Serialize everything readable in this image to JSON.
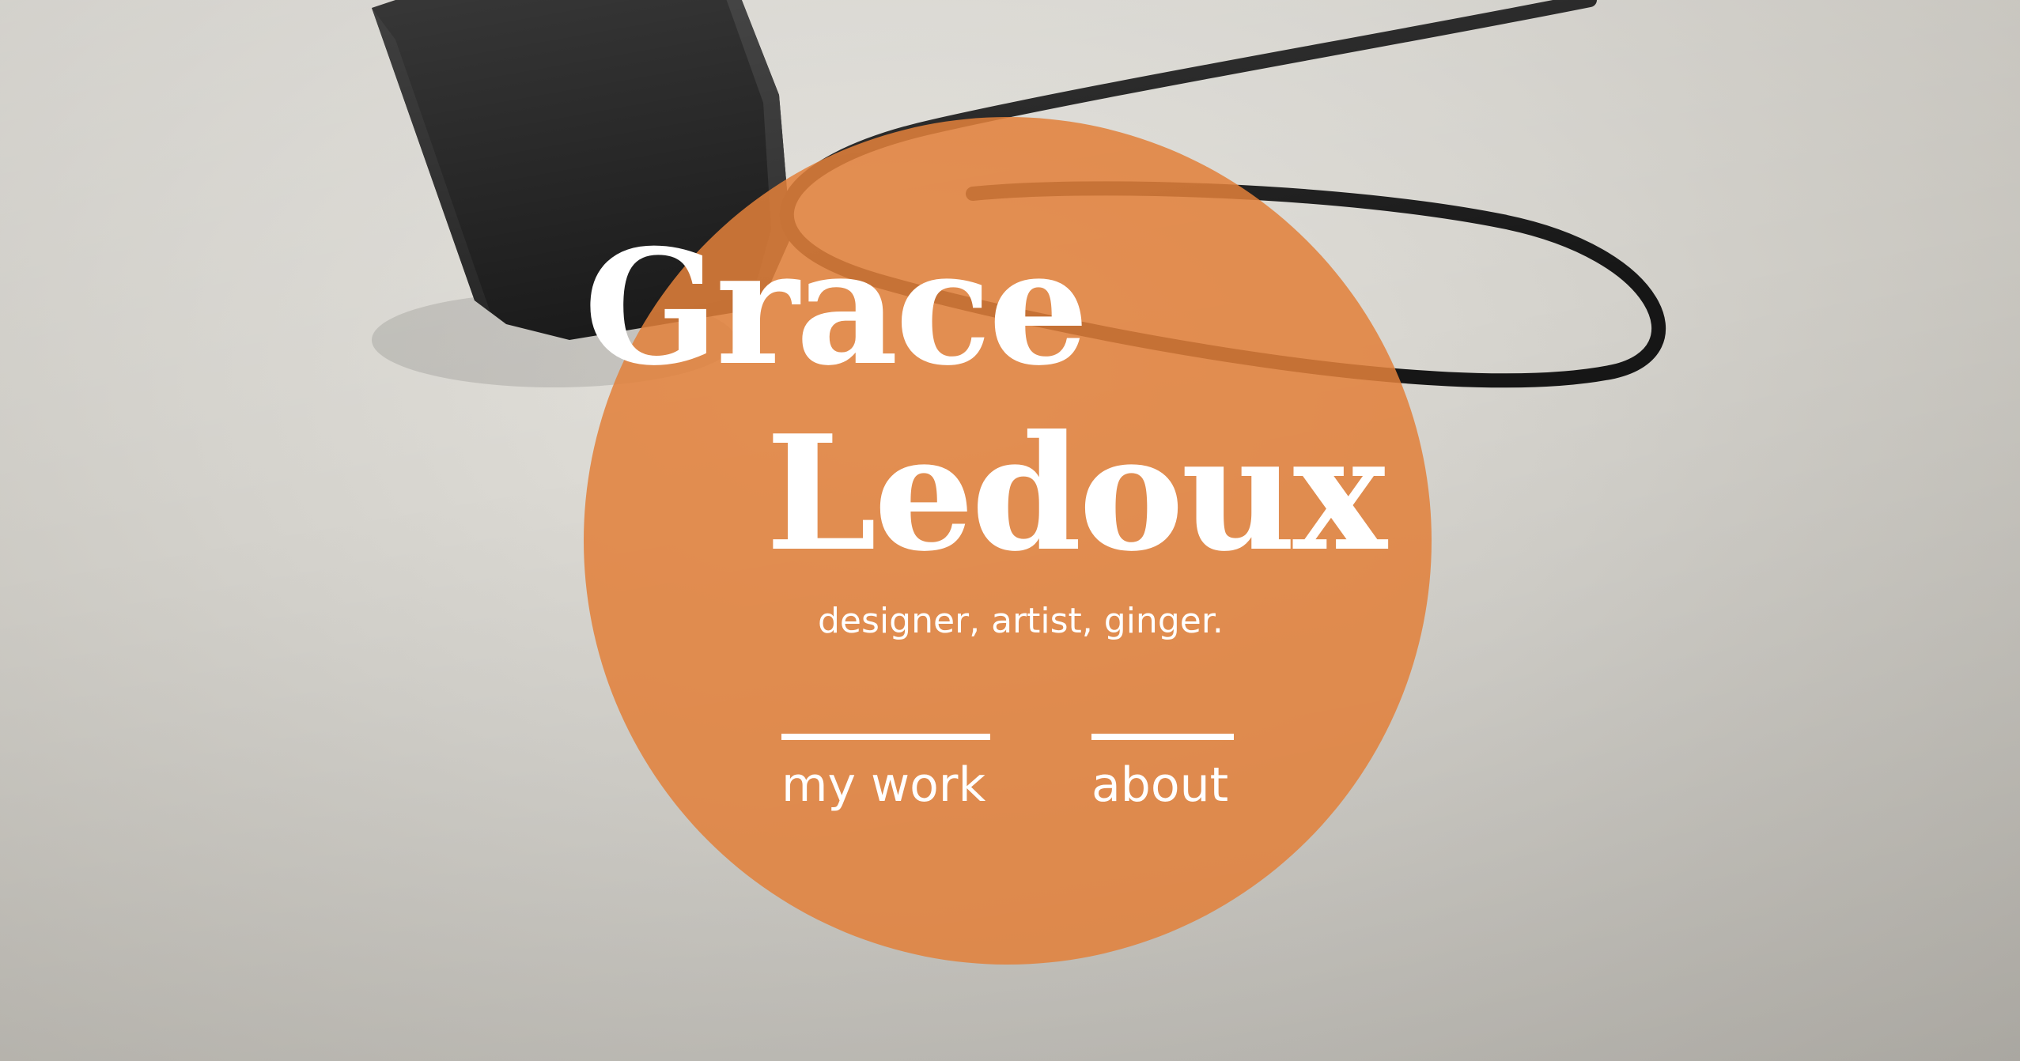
{
  "brand": {
    "first_name": "Grace",
    "last_name": "Ledoux",
    "tagline": "designer, artist, ginger."
  },
  "nav": {
    "items": [
      {
        "label": "my work"
      },
      {
        "label": "about"
      }
    ]
  },
  "colors": {
    "accent_circle": "#e2803a",
    "text": "#ffffff",
    "paper": "#d4d2cc",
    "ink": "#141414"
  }
}
